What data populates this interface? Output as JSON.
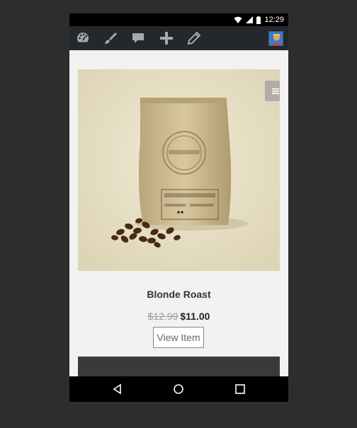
{
  "status_bar": {
    "time": "12:29"
  },
  "admin_bar": {
    "icons": [
      "dashboard-icon",
      "customize-brush-icon",
      "comments-icon",
      "new-content-plus-icon",
      "edit-pencil-icon"
    ],
    "avatar": "user-avatar"
  },
  "product": {
    "image": "coffee-bag-with-beans",
    "menu_icon": "hamburger-menu-icon",
    "title": "Blonde Roast",
    "old_price": "$12.99",
    "price": "$11.00",
    "view_button": "View Item"
  },
  "nav_bar": {
    "buttons": [
      "back-icon",
      "home-icon",
      "recent-apps-icon"
    ]
  }
}
